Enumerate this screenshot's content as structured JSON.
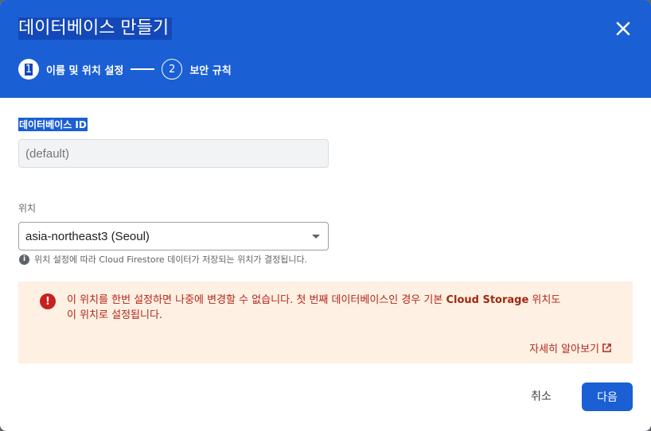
{
  "header": {
    "title": "데이터베이스 만들기",
    "steps": [
      {
        "number": "1",
        "label": "이름 및 위치 설정",
        "state": "active"
      },
      {
        "number": "2",
        "label": "보안 규칙",
        "state": "inactive"
      }
    ]
  },
  "form": {
    "database_id": {
      "label": "데이터베이스 ID",
      "placeholder": "(default)"
    },
    "location": {
      "label": "위치",
      "selected": "asia-northeast3 (Seoul)",
      "hint": "위치 설정에 따라 Cloud Firestore 데이터가 저장되는 위치가 결정됩니다."
    }
  },
  "warning": {
    "text_line1_prefix": "이 위치를 한번 설정하면 나중에 변경할 수 없습니다. 첫 번째 데이터베이스인 경우 기본 ",
    "text_line1_bold": "Cloud Storage",
    "text_line1_suffix": " 위치도",
    "text_line2": "이 위치로 설정됩니다.",
    "learn_more": "자세히 알아보기"
  },
  "footer": {
    "cancel_label": "취소",
    "next_label": "다음"
  },
  "colors": {
    "primary": "#1a5fd4",
    "warning_bg": "#fef0e2",
    "warning_text": "#b3261e"
  }
}
